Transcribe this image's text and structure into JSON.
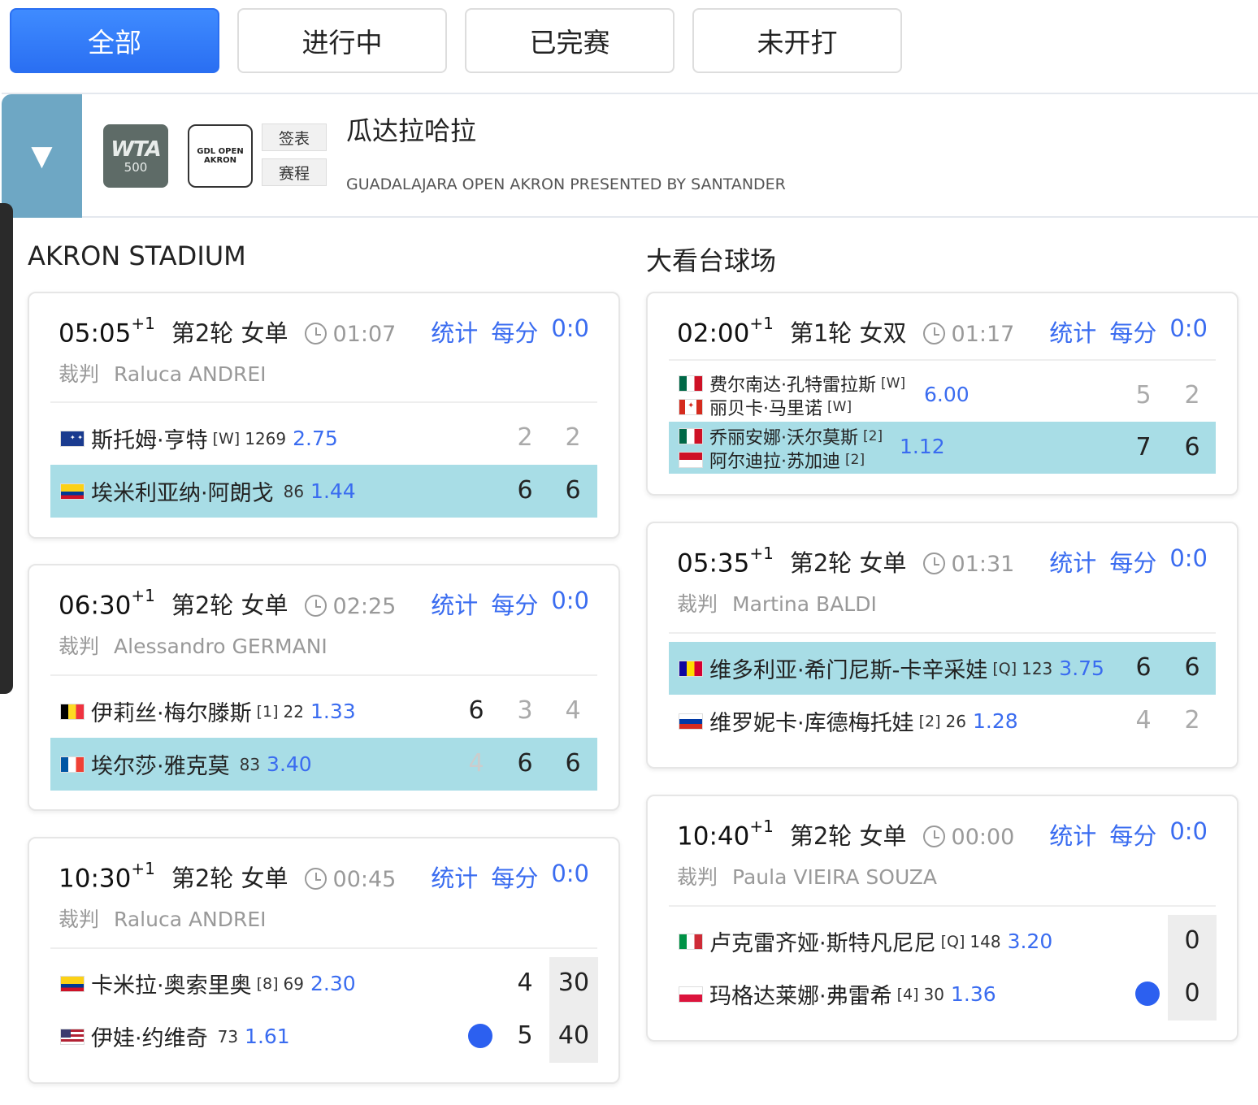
{
  "filters": [
    {
      "label": "全部",
      "active": true
    },
    {
      "label": "进行中",
      "active": false
    },
    {
      "label": "已完赛",
      "active": false
    },
    {
      "label": "未开打",
      "active": false
    }
  ],
  "tournament": {
    "collapse_icon": "▼",
    "wta_logo_text": "WTA",
    "wta_logo_level": "500",
    "gdl_logo_text": "GDL OPEN AKRON",
    "draw_label": "签表",
    "schedule_label": "赛程",
    "name": "瓜达拉哈拉",
    "subtitle": "GUADALAJARA OPEN AKRON PRESENTED BY SANTANDER"
  },
  "labels": {
    "stats": "统计",
    "per_point": "每分",
    "score_label": "0:0",
    "referee": "裁判"
  },
  "venues": {
    "left": "AKRON STADIUM",
    "right": "大看台球场"
  },
  "matches": {
    "m1": {
      "time": "05:05",
      "plus": "+1",
      "round": "第2轮",
      "type": "女单",
      "duration": "01:07",
      "referee": "Raluca ANDREI",
      "p1": {
        "name": "斯托姆·亨特",
        "seed": "[W]",
        "rank": "1269",
        "odds": "2.75",
        "s1": "2",
        "s2": "2"
      },
      "p2": {
        "name": "埃米利亚纳·阿朗戈",
        "seed": "",
        "rank": "86",
        "odds": "1.44",
        "s1": "6",
        "s2": "6"
      }
    },
    "m2": {
      "time": "06:30",
      "plus": "+1",
      "round": "第2轮",
      "type": "女单",
      "duration": "02:25",
      "referee": "Alessandro GERMANI",
      "p1": {
        "name": "伊莉丝·梅尔滕斯",
        "seed": "[1]",
        "rank": "22",
        "odds": "1.33",
        "s1": "6",
        "s2": "3",
        "s3": "4"
      },
      "p2": {
        "name": "埃尔莎·雅克莫",
        "seed": "",
        "rank": "83",
        "odds": "3.40",
        "s1": "4",
        "s2": "6",
        "s3": "6"
      }
    },
    "m3": {
      "time": "10:30",
      "plus": "+1",
      "round": "第2轮",
      "type": "女单",
      "duration": "00:45",
      "referee": "Raluca ANDREI",
      "p1": {
        "name": "卡米拉·奥索里奥",
        "seed": "[8]",
        "rank": "69",
        "odds": "2.30",
        "s1": "4",
        "pt": "30"
      },
      "p2": {
        "name": "伊娃·约维奇",
        "seed": "",
        "rank": "73",
        "odds": "1.61",
        "s1": "5",
        "pt": "40"
      }
    },
    "m4": {
      "time": "02:00",
      "plus": "+1",
      "round": "第1轮",
      "type": "女双",
      "duration": "01:17",
      "t1": {
        "a": "费尔南达·孔特雷拉斯",
        "a_seed": "[W]",
        "b": "丽贝卡·马里诺",
        "b_seed": "[W]",
        "odds": "6.00",
        "s1": "5",
        "s2": "2"
      },
      "t2": {
        "a": "乔丽安娜·沃尔莫斯",
        "a_seed": "[2]",
        "b": "阿尔迪拉·苏加迪",
        "b_seed": "[2]",
        "odds": "1.12",
        "s1": "7",
        "s2": "6"
      }
    },
    "m5": {
      "time": "05:35",
      "plus": "+1",
      "round": "第2轮",
      "type": "女单",
      "duration": "01:31",
      "referee": "Martina BALDI",
      "p1": {
        "name": "维多利亚·希门尼斯-卡辛采娃",
        "seed": "[Q]",
        "rank": "123",
        "odds": "3.75",
        "s1": "6",
        "s2": "6"
      },
      "p2": {
        "name": "维罗妮卡·库德梅托娃",
        "seed": "[2]",
        "rank": "26",
        "odds": "1.28",
        "s1": "4",
        "s2": "2"
      }
    },
    "m6": {
      "time": "10:40",
      "plus": "+1",
      "round": "第2轮",
      "type": "女单",
      "duration": "00:00",
      "referee": "Paula VIEIRA SOUZA",
      "p1": {
        "name": "卢克雷齐娅·斯特凡尼尼",
        "seed": "[Q]",
        "rank": "148",
        "odds": "3.20",
        "pt": "0"
      },
      "p2": {
        "name": "玛格达莱娜·弗雷希",
        "seed": "[4]",
        "rank": "30",
        "odds": "1.36",
        "pt": "0"
      }
    }
  },
  "colors": {
    "accent": "#3a6cf0",
    "winner_row": "#a8dde6",
    "serve_dot": "#2c60f0",
    "collapse": "#6ea7c4"
  }
}
